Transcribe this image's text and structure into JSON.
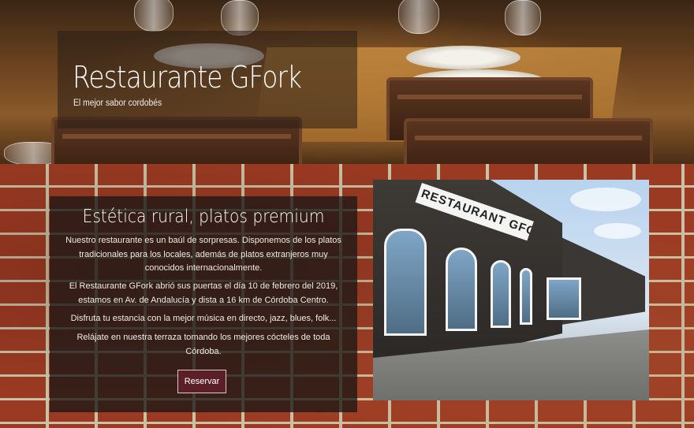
{
  "hero": {
    "title": "Restaurante GFork",
    "subtitle": "El mejor sabor cordobés"
  },
  "info": {
    "title": "Estética rural, platos premium",
    "paragraphs": [
      "Nuestro restaurante es un baúl de sorpresas. Disponemos de los platos tradicionales para los locales, además de platos extranjeros muy conocidos internacionalmente.",
      "El Restaurante GFork abrió sus puertas el día 10 de febrero del 2019, estamos en Av. de Andalucía y dista a 16 km de Córdoba Centro.",
      "Disfruta tu estancia con la mejor música en directo, jazz, blues, folk...",
      "Relájate en nuestra terraza tomando los mejores cócteles de toda Córdoba."
    ],
    "button_label": "Reservar"
  },
  "photo": {
    "sign_text": "RESTAURANT GFORK"
  },
  "colors": {
    "button_bg": "#5a1f27",
    "overlay": "#1c1816"
  }
}
